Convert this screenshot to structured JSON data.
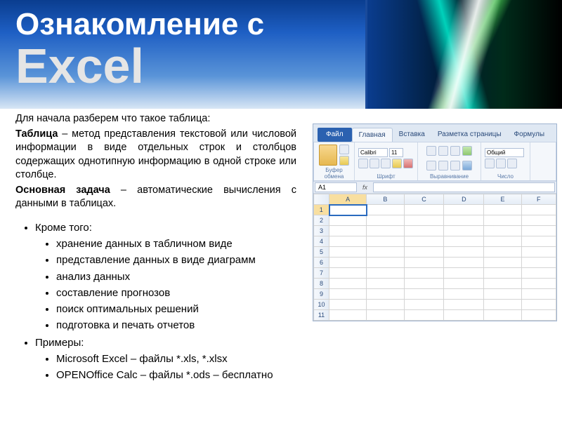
{
  "title": {
    "line1": "Ознакомление с",
    "line2": "Excel"
  },
  "content": {
    "intro": "Для начала разберем что такое таблица:",
    "def_term": "Таблица",
    "def_body": " – метод представления текстовой или числовой информации в виде отдельных строк и столбцов содержащих однотипную информацию в одной строке или столбце.",
    "task_term": "Основная задача",
    "task_body": " – автоматические вычисления с данными в таблицах.",
    "also_label": "Кроме того:",
    "also_items": [
      "хранение данных в табличном виде",
      "представление данных в виде диаграмм",
      "анализ данных",
      "составление прогнозов",
      "поиск оптимальных решений",
      "подготовка и печать отчетов"
    ],
    "examples_label": "Примеры:",
    "examples_items": [
      "Microsoft Excel – файлы *.xls, *.xlsx",
      "OPENOffice Calc – файлы *.ods – бесплатно"
    ]
  },
  "excel": {
    "tabs": {
      "file": "Файл",
      "home": "Главная",
      "insert": "Вставка",
      "layout": "Разметка страницы",
      "formulas": "Формулы"
    },
    "ribbon_groups": {
      "clipboard": "Буфер обмена",
      "font": "Шрифт",
      "alignment": "Выравнивание",
      "number": "Число"
    },
    "font_name": "Calibri",
    "font_size": "11",
    "number_format": "Общий",
    "name_box": "A1",
    "fx_label": "fx",
    "columns": [
      "A",
      "B",
      "C",
      "D",
      "E",
      "F"
    ],
    "rows": [
      "1",
      "2",
      "3",
      "4",
      "5",
      "6",
      "7",
      "8",
      "9",
      "10",
      "11"
    ]
  }
}
